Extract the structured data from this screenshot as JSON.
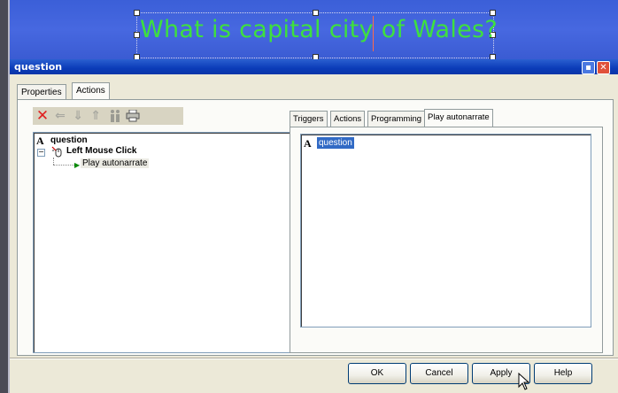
{
  "slide": {
    "question_text": "What is capital city of Wales?"
  },
  "dialog": {
    "title": "question",
    "min_glyph": "▪",
    "close_glyph": "✕",
    "tabs": [
      "Properties",
      "Actions"
    ],
    "tree": {
      "root_icon": "A",
      "root_label": "question",
      "expander": "−",
      "event_label": "Left Mouse Click",
      "action_label": "Play autonarrate"
    },
    "right_tabs": [
      "Triggers",
      "Actions",
      "Programming",
      "Play autonarrate"
    ],
    "right_panel": {
      "item_icon": "A",
      "item_label": "question"
    },
    "buttons": {
      "ok": "OK",
      "cancel": "Cancel",
      "apply": "Apply",
      "help": "Help"
    }
  },
  "colors": {
    "slide_bg": "#4768e0",
    "question_text": "#3ee03e",
    "titlebar": "#0b3bb8",
    "delete_icon": "#e02020",
    "selection": "#316ac5"
  },
  "icons": [
    "delete-icon",
    "arrow-left-icon",
    "arrow-down-icon",
    "arrow-up-icon",
    "person-icon",
    "printer-icon",
    "cursor-hand-icon",
    "play-triangle-icon"
  ]
}
